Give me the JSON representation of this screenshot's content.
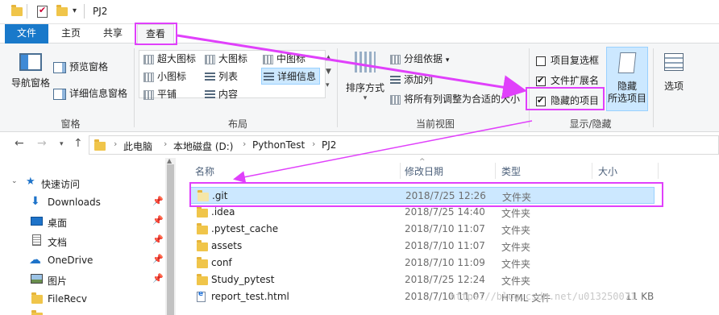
{
  "window": {
    "title": "PJ2"
  },
  "ribbon_tabs": [
    "文件",
    "主页",
    "共享",
    "查看"
  ],
  "ribbon": {
    "panes": {
      "nav_pane": "导航窗格",
      "preview_pane": "预览窗格",
      "details_pane": "详细信息窗格",
      "group_label": "窗格"
    },
    "layout": {
      "items": [
        "超大图标",
        "大图标",
        "中图标",
        "小图标",
        "列表",
        "详细信息",
        "平铺",
        "内容"
      ],
      "group_label": "布局"
    },
    "current_view": {
      "sort_by": "排序方式",
      "group_by": "分组依据",
      "add_columns": "添加列",
      "fit_columns": "将所有列调整为合适的大小",
      "group_label": "当前视图"
    },
    "show_hide": {
      "item_checkboxes": {
        "label": "项目复选框",
        "checked": false
      },
      "file_extensions": {
        "label": "文件扩展名",
        "checked": true
      },
      "hidden_items": {
        "label": "隐藏的项目",
        "checked": true
      },
      "hide_selected_line1": "隐藏",
      "hide_selected_line2": "所选项目",
      "group_label": "显示/隐藏"
    },
    "options": "选项"
  },
  "address": {
    "crumbs": [
      "此电脑",
      "本地磁盘 (D:)",
      "PythonTest",
      "PJ2"
    ]
  },
  "sidebar": {
    "items": [
      {
        "label": "快速访问",
        "icon": "star-icon",
        "pinned": false
      },
      {
        "label": "Downloads",
        "icon": "download-icon",
        "pinned": true
      },
      {
        "label": "桌面",
        "icon": "desktop-icon",
        "pinned": true
      },
      {
        "label": "文档",
        "icon": "document-icon",
        "pinned": true
      },
      {
        "label": "OneDrive",
        "icon": "cloud-icon",
        "pinned": true
      },
      {
        "label": "图片",
        "icon": "pictures-icon",
        "pinned": true
      },
      {
        "label": "FileRecv",
        "icon": "folder-icon",
        "pinned": false
      }
    ]
  },
  "filelist": {
    "columns": [
      "名称",
      "修改日期",
      "类型",
      "大小"
    ],
    "rows": [
      {
        "name": ".git",
        "date": "2018/7/25 12:26",
        "type": "文件夹",
        "size": "",
        "kind": "folder",
        "selected": true
      },
      {
        "name": ".idea",
        "date": "2018/7/25 14:40",
        "type": "文件夹",
        "size": "",
        "kind": "folder",
        "selected": false
      },
      {
        "name": ".pytest_cache",
        "date": "2018/7/10 11:07",
        "type": "文件夹",
        "size": "",
        "kind": "folder",
        "selected": false
      },
      {
        "name": "assets",
        "date": "2018/7/10 11:07",
        "type": "文件夹",
        "size": "",
        "kind": "folder",
        "selected": false
      },
      {
        "name": "conf",
        "date": "2018/7/10 11:09",
        "type": "文件夹",
        "size": "",
        "kind": "folder",
        "selected": false
      },
      {
        "name": "Study_pytest",
        "date": "2018/7/25 12:24",
        "type": "文件夹",
        "size": "",
        "kind": "folder",
        "selected": false
      },
      {
        "name": "report_test.html",
        "date": "2018/7/10 11:07",
        "type": "HTML 文件",
        "size": "11 KB",
        "kind": "html",
        "selected": false
      }
    ]
  },
  "watermark": "https://blog.csdn.net/u013250071",
  "colors": {
    "accent": "#1979ca",
    "annotation": "#e040fb",
    "selection": "#cce8ff"
  }
}
